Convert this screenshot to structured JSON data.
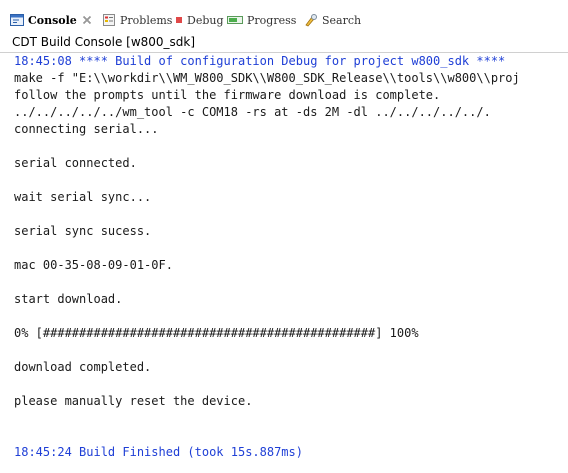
{
  "tabs": [
    {
      "id": "console",
      "label": "Console",
      "active": true,
      "icon": "console-icon"
    },
    {
      "id": "problems",
      "label": "Problems",
      "active": false,
      "icon": "problems-icon"
    },
    {
      "id": "debug",
      "label": "Debug",
      "active": false,
      "icon": "debug-icon"
    },
    {
      "id": "progress",
      "label": "Progress",
      "active": false,
      "icon": "progress-icon"
    },
    {
      "id": "search",
      "label": "Search",
      "active": false,
      "icon": "search-icon"
    }
  ],
  "console": {
    "title": "CDT Build Console [w800_sdk]",
    "lines": [
      {
        "text": "18:45:08 **** Build of configuration Debug for project w800_sdk ****",
        "style": "blue"
      },
      {
        "text": "make -f \"E:\\\\workdir\\\\WM_W800_SDK\\\\W800_SDK_Release\\\\tools\\\\w800\\\\proj",
        "style": "normal"
      },
      {
        "text": "follow the prompts until the firmware download is complete.",
        "style": "normal"
      },
      {
        "text": "../../../../../wm_tool -c COM18 -rs at -ds 2M -dl ../../../../../.",
        "style": "normal"
      },
      {
        "text": "connecting serial...",
        "style": "normal"
      },
      {
        "text": "",
        "style": "normal"
      },
      {
        "text": "serial connected.",
        "style": "normal"
      },
      {
        "text": "",
        "style": "normal"
      },
      {
        "text": "wait serial sync...",
        "style": "normal"
      },
      {
        "text": "",
        "style": "normal"
      },
      {
        "text": "serial sync sucess.",
        "style": "normal"
      },
      {
        "text": "",
        "style": "normal"
      },
      {
        "text": "mac 00-35-08-09-01-0F.",
        "style": "normal"
      },
      {
        "text": "",
        "style": "normal"
      },
      {
        "text": "start download.",
        "style": "normal"
      },
      {
        "text": "",
        "style": "normal"
      },
      {
        "text": "0% [##############################################] 100%",
        "style": "normal"
      },
      {
        "text": "",
        "style": "normal"
      },
      {
        "text": "download completed.",
        "style": "normal"
      },
      {
        "text": "",
        "style": "normal"
      },
      {
        "text": "please manually reset the device.",
        "style": "normal"
      },
      {
        "text": "",
        "style": "normal"
      },
      {
        "text": "",
        "style": "normal"
      },
      {
        "text": "18:45:24 Build Finished (took 15s.887ms)",
        "style": "blue"
      }
    ]
  },
  "colors": {
    "accent_blue": "#1f3fd6",
    "text": "#1a1a1a",
    "tab_border": "#c8c8c8"
  }
}
